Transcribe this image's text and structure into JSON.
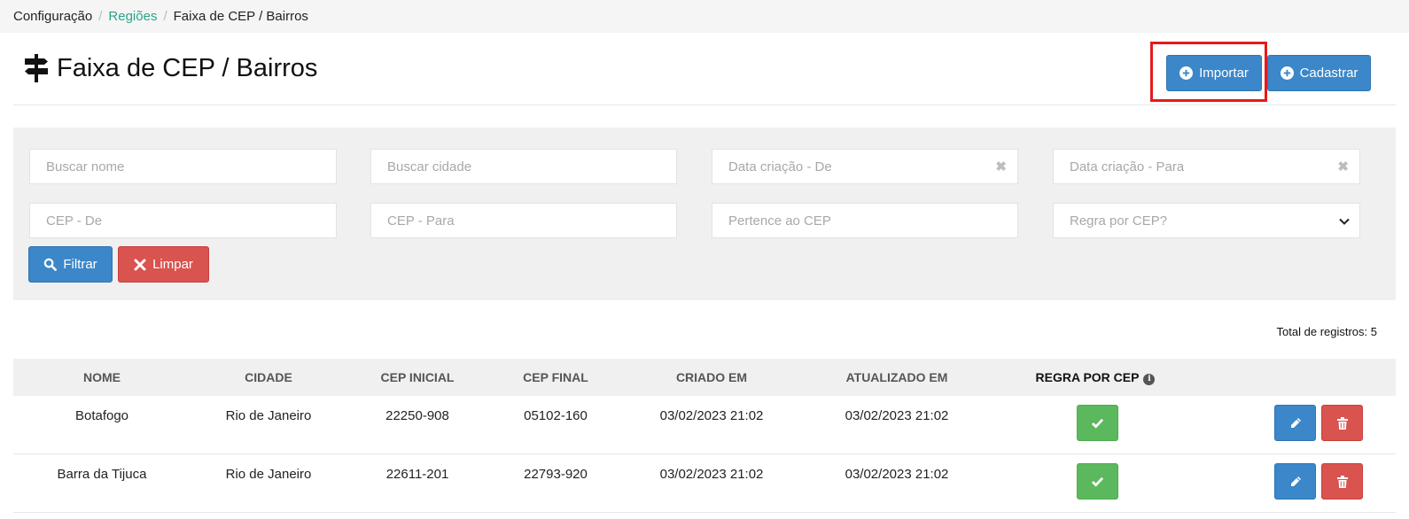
{
  "breadcrumb": {
    "items": [
      "Configuração",
      "Regiões",
      "Faixa de CEP / Bairros"
    ],
    "separator": "/"
  },
  "page": {
    "title": "Faixa de CEP / Bairros",
    "title_icon": "signpost-icon"
  },
  "actions": {
    "import_label": "Importar",
    "create_label": "Cadastrar"
  },
  "filters": {
    "nome_placeholder": "Buscar nome",
    "cidade_placeholder": "Buscar cidade",
    "data_de_placeholder": "Data criação - De",
    "data_para_placeholder": "Data criação - Para",
    "cep_de_placeholder": "CEP - De",
    "cep_para_placeholder": "CEP - Para",
    "pertence_placeholder": "Pertence ao CEP",
    "regra_placeholder": "Regra por CEP?",
    "clear_glyph": "✖",
    "filter_label": "Filtrar",
    "clear_label": "Limpar"
  },
  "total": "Total de registros: 5",
  "table": {
    "headers": [
      "NOME",
      "CIDADE",
      "CEP INICIAL",
      "CEP FINAL",
      "CRIADO EM",
      "ATUALIZADO EM",
      "REGRA POR CEP"
    ],
    "info_glyph": "i",
    "rows": [
      {
        "nome": "Botafogo",
        "cidade": "Rio de Janeiro",
        "cep_inicial": "22250-908",
        "cep_final": "05102-160",
        "criado": "03/02/2023 21:02",
        "atualizado": "03/02/2023 21:02"
      },
      {
        "nome": "Barra da Tijuca",
        "cidade": "Rio de Janeiro",
        "cep_inicial": "22611-201",
        "cep_final": "22793-920",
        "criado": "03/02/2023 21:02",
        "atualizado": "03/02/2023 21:02"
      }
    ]
  },
  "colors": {
    "primary": "#3b87c9",
    "danger": "#d9534f",
    "success": "#5cb85c",
    "link": "#2aa58a",
    "highlight": "#e51b1b"
  }
}
